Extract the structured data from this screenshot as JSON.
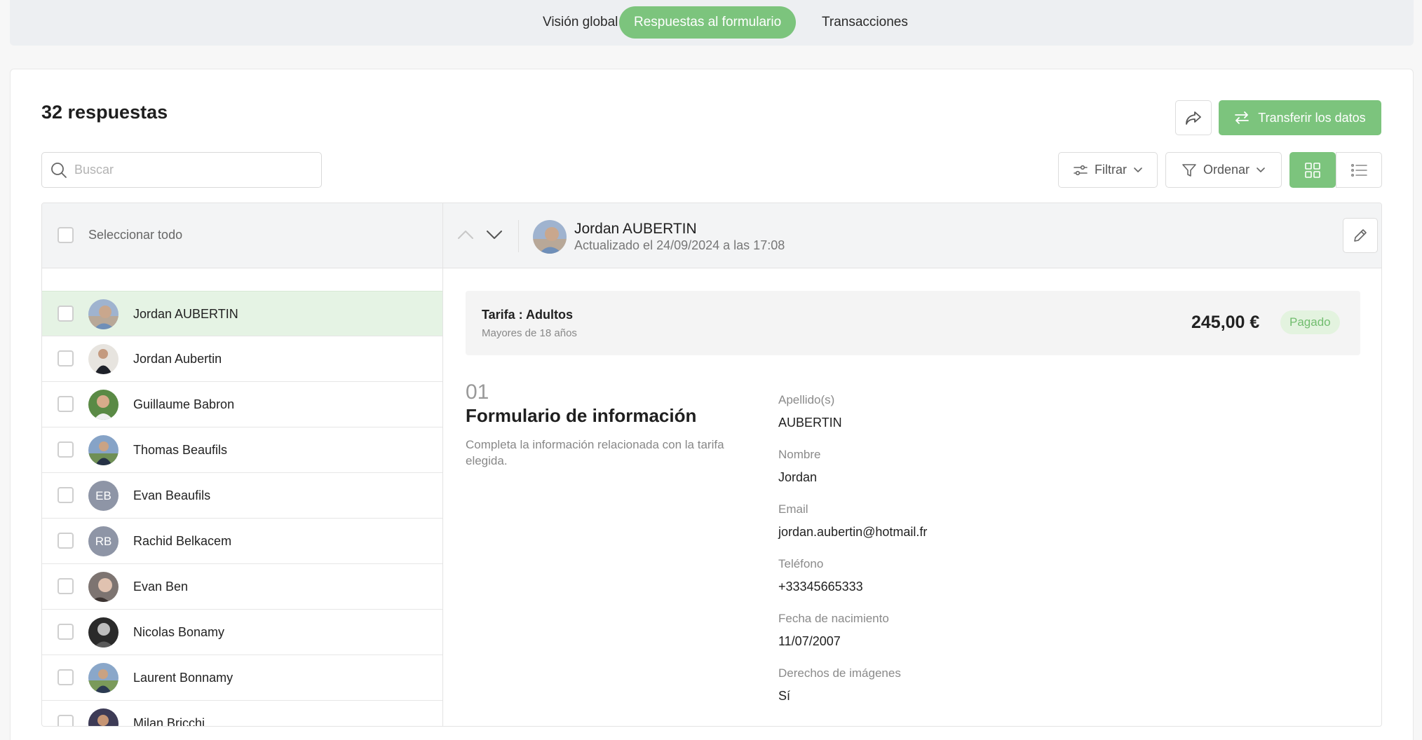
{
  "tabs": [
    {
      "label": "Visión global",
      "active": false
    },
    {
      "label": "Respuestas al formulario",
      "active": true
    },
    {
      "label": "Transacciones",
      "active": false
    }
  ],
  "header": {
    "count_title": "32 respuestas",
    "transfer_label": "Transferir los datos"
  },
  "toolbar": {
    "search_placeholder": "Buscar",
    "filter_label": "Filtrar",
    "sort_label": "Ordenar"
  },
  "list": {
    "select_all_label": "Seleccionar todo",
    "items": [
      {
        "name": "Jordan AUBERTIN",
        "initials": "",
        "selected": true
      },
      {
        "name": "Jordan Aubertin",
        "initials": "",
        "selected": false
      },
      {
        "name": "Guillaume Babron",
        "initials": "",
        "selected": false
      },
      {
        "name": "Thomas Beaufils",
        "initials": "",
        "selected": false
      },
      {
        "name": "Evan Beaufils",
        "initials": "EB",
        "selected": false
      },
      {
        "name": "Rachid Belkacem",
        "initials": "RB",
        "selected": false
      },
      {
        "name": "Evan Ben",
        "initials": "",
        "selected": false
      },
      {
        "name": "Nicolas Bonamy",
        "initials": "",
        "selected": false
      },
      {
        "name": "Laurent Bonnamy",
        "initials": "",
        "selected": false
      },
      {
        "name": "Milan Bricchi",
        "initials": "",
        "selected": false
      }
    ]
  },
  "detail": {
    "name": "Jordan AUBERTIN",
    "updated": "Actualizado el 24/09/2024 a las 17:08",
    "tariff": {
      "title": "Tarifa : Adultos",
      "subtitle": "Mayores de 18 años",
      "price": "245,00 €",
      "status": "Pagado"
    },
    "section": {
      "number": "01",
      "title": "Formulario de información",
      "description": "Completa la información relacionada con la tarifa elegida."
    },
    "fields": [
      {
        "label": "Apellido(s)",
        "value": "AUBERTIN"
      },
      {
        "label": "Nombre",
        "value": "Jordan"
      },
      {
        "label": "Email",
        "value": "jordan.aubertin@hotmail.fr"
      },
      {
        "label": "Teléfono",
        "value": "+33345665333"
      },
      {
        "label": "Fecha de nacimiento",
        "value": "11/07/2007"
      },
      {
        "label": "Derechos de imágenes",
        "value": "Sí"
      }
    ]
  },
  "colors": {
    "accent": "#7cc47d",
    "badge_bg": "#e3f3df",
    "badge_text": "#72bd6f",
    "selected_row": "#e5f3e4",
    "initials_avatar": "#8e95a6"
  }
}
